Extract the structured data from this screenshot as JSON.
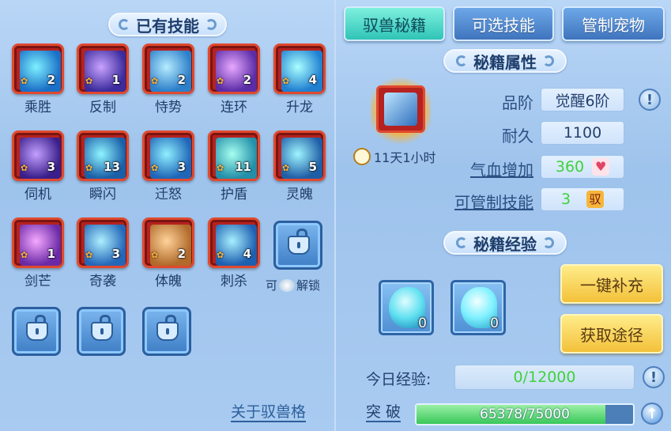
{
  "left_panel": {
    "title": "已有技能",
    "skills": [
      {
        "name": "乘胜",
        "count": "2"
      },
      {
        "name": "反制",
        "count": "1"
      },
      {
        "name": "恃势",
        "count": "2"
      },
      {
        "name": "连环",
        "count": "2"
      },
      {
        "name": "升龙",
        "count": "4"
      },
      {
        "name": "伺机",
        "count": "3"
      },
      {
        "name": "瞬闪",
        "count": "13"
      },
      {
        "name": "迁怒",
        "count": "3"
      },
      {
        "name": "护盾",
        "count": "11"
      },
      {
        "name": "灵魄",
        "count": "5"
      },
      {
        "name": "剑芒",
        "count": "1"
      },
      {
        "name": "奇袭",
        "count": "3"
      },
      {
        "name": "体魄",
        "count": "2"
      },
      {
        "name": "刺杀",
        "count": "4"
      }
    ],
    "unlock_label_prefix": "可",
    "unlock_label_suffix": "解锁",
    "footer_link": "关于驭兽格"
  },
  "tabs": [
    "驭兽秘籍",
    "可选技能",
    "管制宠物"
  ],
  "attributes": {
    "title": "秘籍属性",
    "timer": "11天1小时",
    "quality_label": "品阶",
    "quality_value": "觉醒6阶",
    "durability_label": "耐久",
    "durability_value": "1100",
    "hp_label": "气血增加",
    "hp_value": "360",
    "control_label": "可管制技能",
    "control_value": "3",
    "control_badge": "驭"
  },
  "experience": {
    "title": "秘籍经验",
    "items": [
      {
        "count": "0"
      },
      {
        "count": "0"
      }
    ],
    "refill_button": "一键补充",
    "obtain_button": "获取途径",
    "today_label": "今日经验:",
    "today_value": "0/12000",
    "breakthrough_label": "突 破",
    "breakthrough_value": "65378/75000",
    "breakthrough_progress": 0.872
  },
  "colors": {
    "accent_teal": "#2fc4b6",
    "skill_frame": "#b5221f",
    "gold_button": "#f3c13a",
    "green_value": "#3fd23a"
  }
}
